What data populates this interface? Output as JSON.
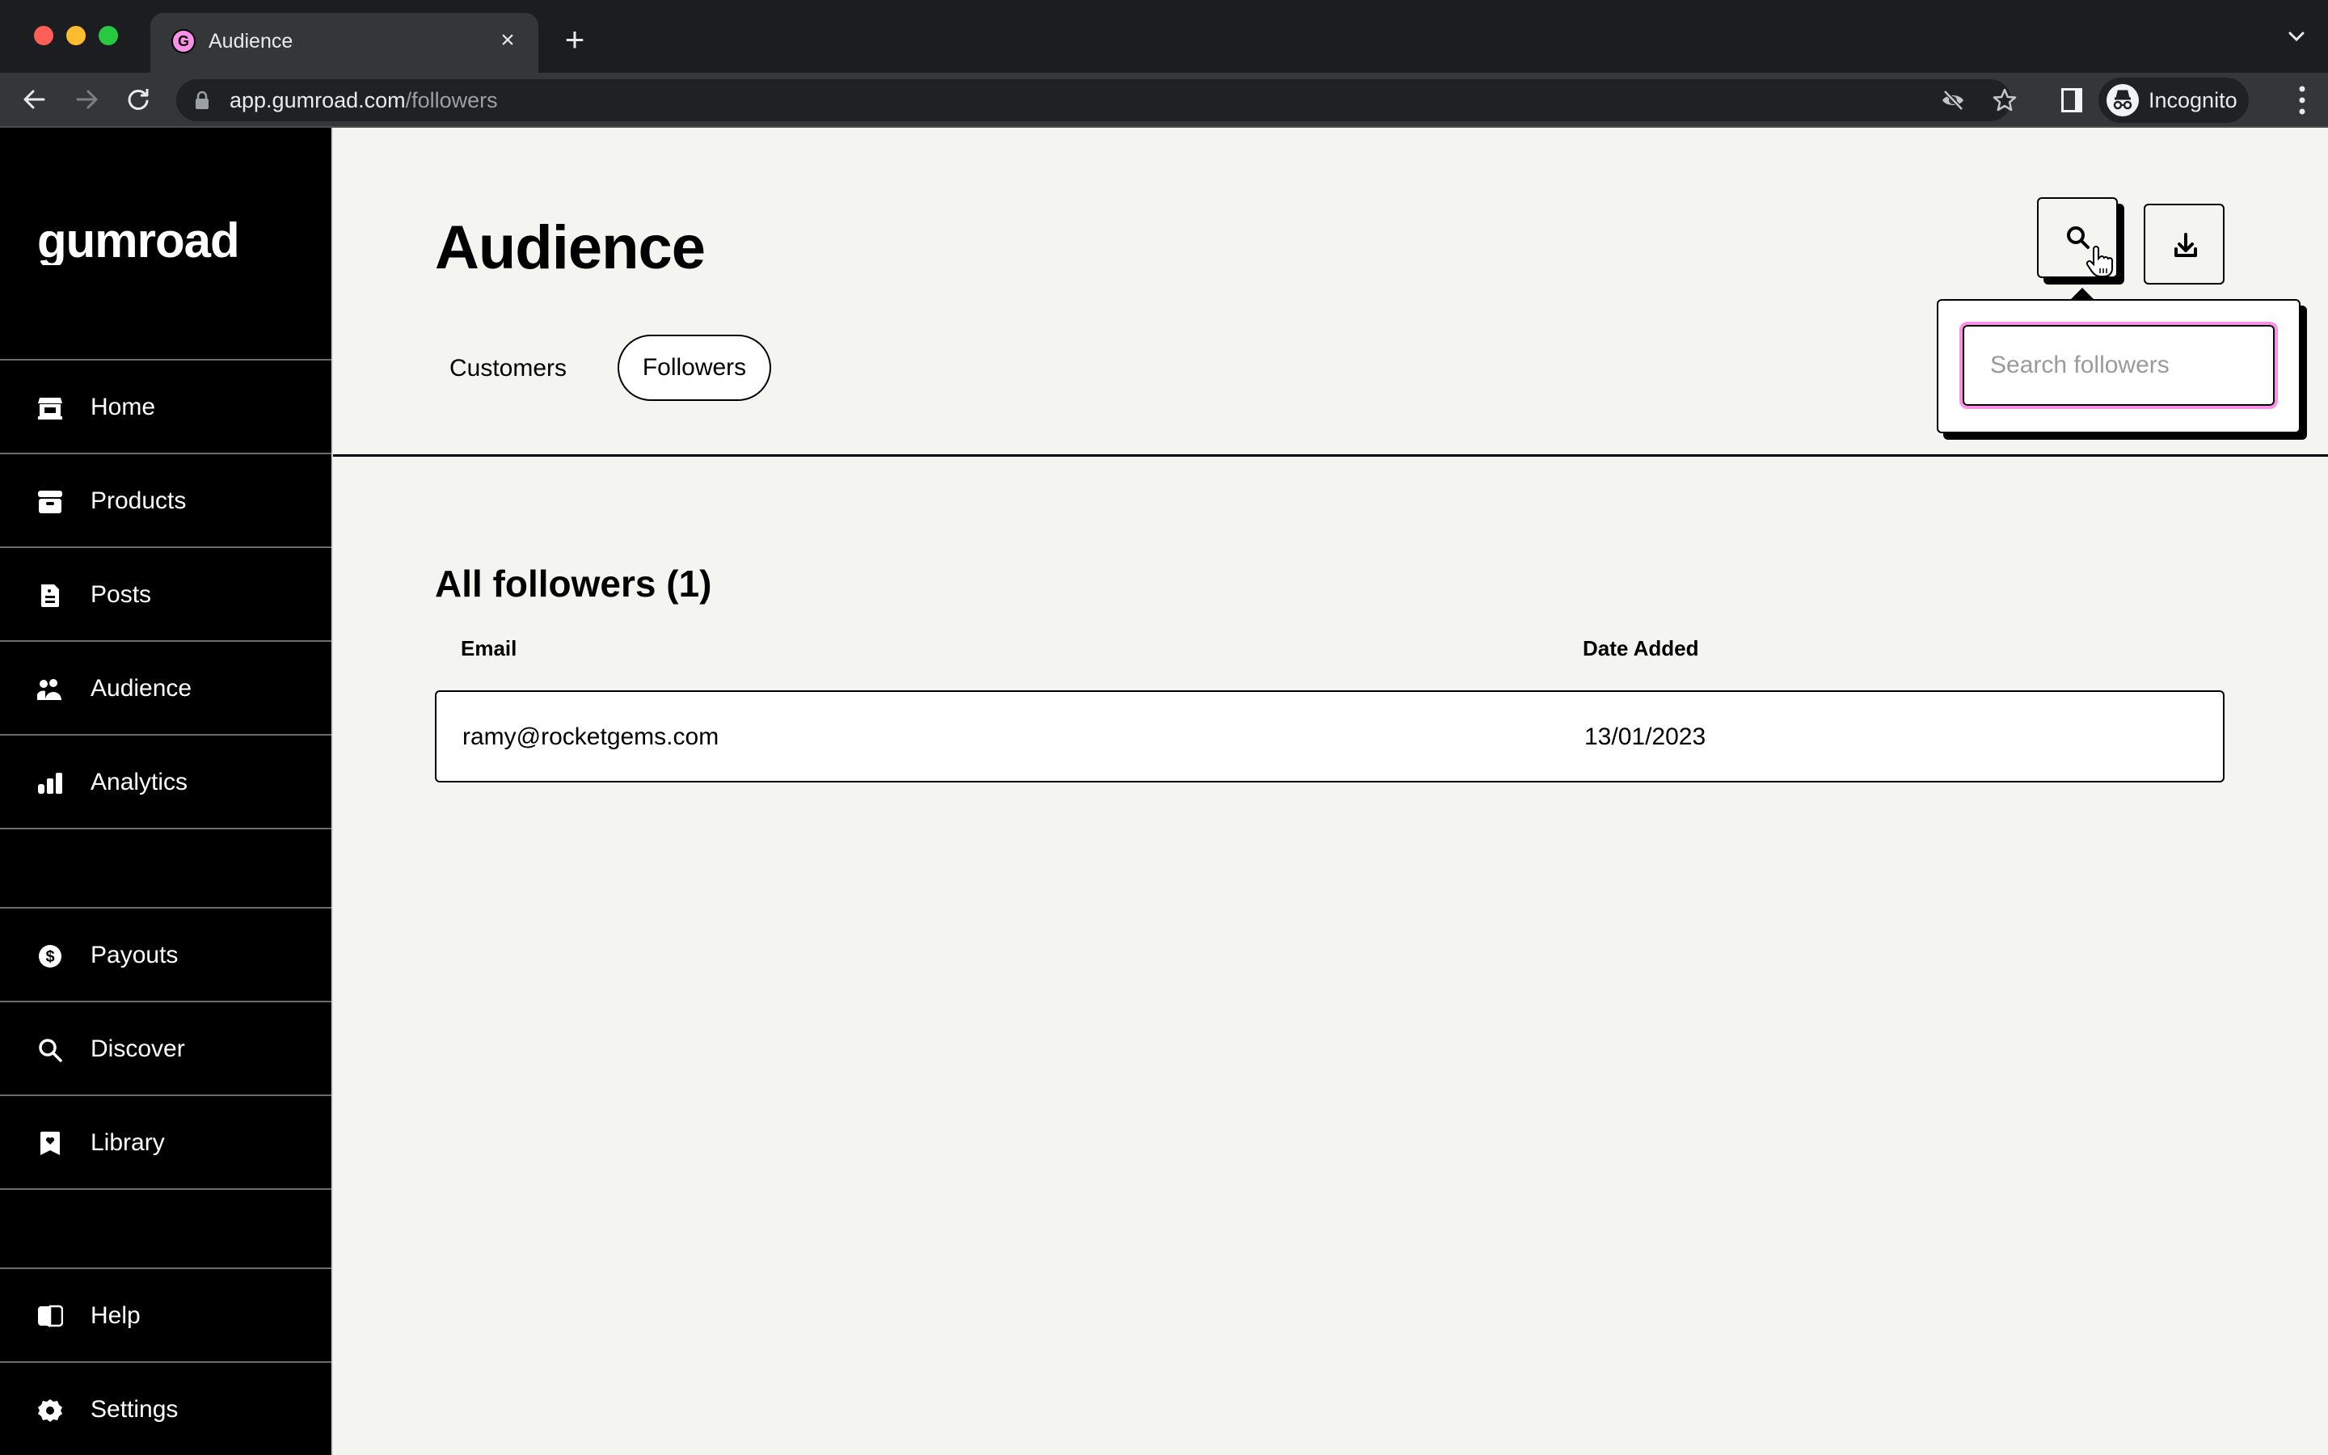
{
  "browser": {
    "tab_title": "Audience",
    "tab_favicon_letter": "G",
    "tab_close_glyph": "×",
    "new_tab_glyph": "+",
    "url_host": "app.gumroad.com",
    "url_path": "/followers",
    "profile_label": "Incognito",
    "icons": [
      "back-icon",
      "forward-icon",
      "reload-icon",
      "lock-icon",
      "eye-off-icon",
      "bookmark-star-icon",
      "side-panel-icon",
      "incognito-icon",
      "more-menu-icon",
      "tab-list-icon"
    ]
  },
  "sidebar": {
    "logo": "gumroad",
    "primary": [
      {
        "label": "Home",
        "icon": "store-icon"
      },
      {
        "label": "Products",
        "icon": "archive-box-icon"
      },
      {
        "label": "Posts",
        "icon": "document-icon"
      },
      {
        "label": "Audience",
        "icon": "people-icon"
      },
      {
        "label": "Analytics",
        "icon": "bar-chart-icon"
      }
    ],
    "secondary": [
      {
        "label": "Payouts",
        "icon": "dollar-circle-icon"
      },
      {
        "label": "Discover",
        "icon": "search-icon"
      },
      {
        "label": "Library",
        "icon": "bookmark-heart-icon"
      }
    ],
    "footer": [
      {
        "label": "Help",
        "icon": "book-open-icon"
      },
      {
        "label": "Settings",
        "icon": "gear-icon"
      }
    ]
  },
  "header": {
    "title": "Audience",
    "tabs": [
      {
        "label": "Customers",
        "active": false
      },
      {
        "label": "Followers",
        "active": true
      }
    ],
    "search_placeholder": "Search followers",
    "search_value": ""
  },
  "followers": {
    "title": "All followers (1)",
    "columns": [
      "Email",
      "Date Added"
    ],
    "rows": [
      {
        "email": "ramy@rocketgems.com",
        "date_added": "13/01/2023"
      }
    ]
  },
  "colors": {
    "accent_pink": "#ff90e8",
    "sidebar_bg": "#000000",
    "page_bg": "#f4f4f0"
  }
}
